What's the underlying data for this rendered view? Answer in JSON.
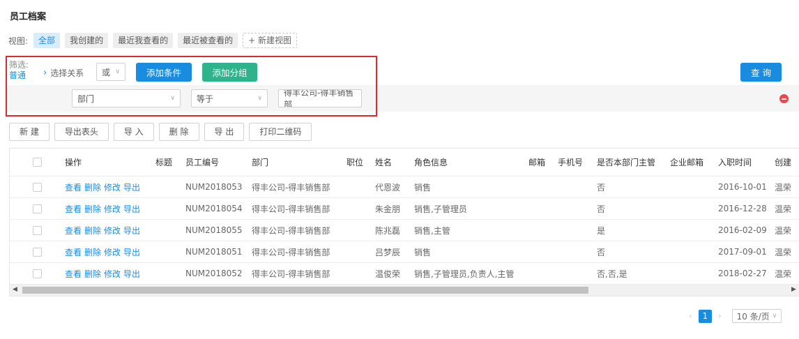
{
  "page": {
    "title": "员工档案"
  },
  "views": {
    "label": "视图:",
    "items": [
      "全部",
      "我创建的",
      "最近我查看的",
      "最近被查看的"
    ],
    "new_label": "+ 新建视图"
  },
  "filter": {
    "label": "筛选:",
    "mode": "普通",
    "relation_label": "选择关系",
    "relation_value": "或",
    "add_condition": "添加条件",
    "add_group": "添加分组",
    "field": "部门",
    "operator": "等于",
    "value": "得丰公司-得丰销售部"
  },
  "query_button": "查 询",
  "toolbar": [
    "新 建",
    "导出表头",
    "导 入",
    "删 除",
    "导 出",
    "打印二维码"
  ],
  "table": {
    "columns": [
      "操作",
      "标题",
      "员工编号",
      "部门",
      "职位",
      "姓名",
      "角色信息",
      "邮箱",
      "手机号",
      "是否本部门主管",
      "企业邮箱",
      "入职时间",
      "创建"
    ],
    "actions": [
      "查看",
      "删除",
      "修改",
      "导出"
    ],
    "rows": [
      {
        "id": "NUM2018053",
        "dept": "得丰公司-得丰销售部",
        "name": "代恩波",
        "roles": "销售",
        "manager": "否",
        "date": "2016-10-01",
        "creator": "温荣"
      },
      {
        "id": "NUM2018054",
        "dept": "得丰公司-得丰销售部",
        "name": "朱金朋",
        "roles": "销售,子管理员",
        "manager": "否",
        "date": "2016-12-28",
        "creator": "温荣"
      },
      {
        "id": "NUM2018055",
        "dept": "得丰公司-得丰销售部",
        "name": "陈兆磊",
        "roles": "销售,主管",
        "manager": "是",
        "date": "2016-02-09",
        "creator": "温荣"
      },
      {
        "id": "NUM2018051",
        "dept": "得丰公司-得丰销售部",
        "name": "吕梦辰",
        "roles": "销售",
        "manager": "否",
        "date": "2017-09-01",
        "creator": "温荣"
      },
      {
        "id": "NUM2018052",
        "dept": "得丰公司-得丰销售部",
        "name": "温俊荣",
        "roles": "销售,子管理员,负责人,主管",
        "manager": "否,否,是",
        "date": "2018-02-27",
        "creator": "温荣"
      }
    ]
  },
  "pagination": {
    "current": "1",
    "page_size": "10 条/页"
  },
  "colors": {
    "primary": "#1a8ce0",
    "success": "#2eb38c",
    "danger": "#e84a4a",
    "highlight_border": "#e0292e"
  }
}
